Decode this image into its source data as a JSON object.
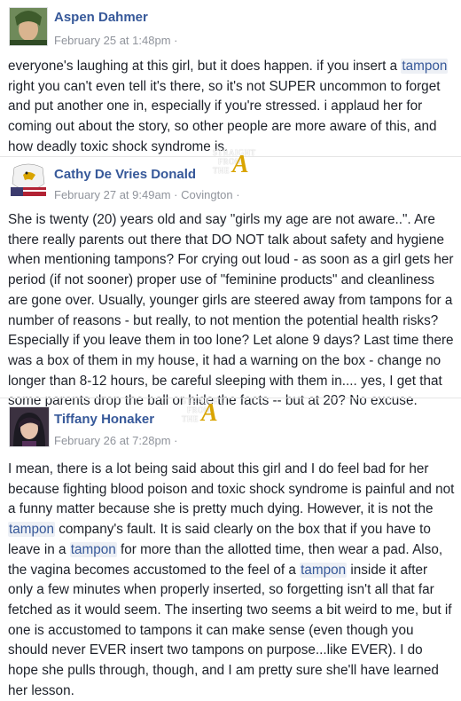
{
  "comments": [
    {
      "author": "Aspen Dahmer",
      "timestamp": "February 25 at 1:48pm",
      "meta_suffix": "·",
      "body_parts": [
        {
          "text": "everyone's laughing at this girl, but it does happen. if you insert a "
        },
        {
          "text": "tampon",
          "link": true
        },
        {
          "text": " right you can't even tell it's there, so it's not SUPER uncommon to forget and put another one in, especially if you're stressed. i applaud her for coming out about the story, so other people are more aware of this, and how deadly toxic shock syndrome is."
        }
      ]
    },
    {
      "author": "Cathy De Vries Donald",
      "timestamp": "February 27 at 9:49am",
      "meta_suffix": "· Covington ·",
      "body_parts": [
        {
          "text": "She is twenty (20) years old and say \"girls my age are not aware..\". Are there really parents out there that DO NOT talk about safety and hygiene when mentioning tampons? For crying out loud - as soon as a girl gets her period (if not sooner) proper use of \"feminine products\" and cleanliness are gone over. Usually, younger girls are steered away from tampons for a number of reasons - but really, to not mention the potential health risks? Especially if you leave them in too lone? Let alone 9 days? Last time there was a box of them in my house, it had a warning on the box - change no longer than 8-12 hours, be careful sleeping with them in.... yes, I get that some parents drop the ball or hide the facts -- but at 20? No excuse."
        }
      ]
    },
    {
      "author": "Tiffany Honaker",
      "timestamp": "February 26 at 7:28pm",
      "meta_suffix": "·",
      "body_parts": [
        {
          "text": "I mean, there is a lot being said about this girl and I do feel bad for her because fighting blood poison and toxic shock syndrome is painful and not a funny matter because she is pretty much dying. However, it is not the "
        },
        {
          "text": "tampon",
          "link": true
        },
        {
          "text": " company's fault. It is said clearly on the box that if you have to leave in a "
        },
        {
          "text": "tampon",
          "link": true
        },
        {
          "text": " for more than the allotted time, then wear a pad. Also, the vagina becomes accustomed to the feel of a "
        },
        {
          "text": "tampon",
          "link": true
        },
        {
          "text": " inside it after only a few minutes when properly inserted, so forgetting isn't all that far fetched as it would seem. The inserting two seems a bit weird to me, but if one is accustomed to tampons it can make sense (even though you should never EVER insert two tampons on purpose...like EVER). I do hope she pulls through, though, and I am pretty sure she'll have learned her lesson."
        }
      ]
    }
  ],
  "watermark": {
    "line1": "STRAIGHT",
    "line2": "FROM",
    "line3": "THE",
    "letter": "A"
  },
  "colors": {
    "name": "#365899",
    "meta": "#90949c",
    "text": "#1d2129",
    "link_bg": "#edf0f5",
    "watermark_a": "#d9a400"
  }
}
